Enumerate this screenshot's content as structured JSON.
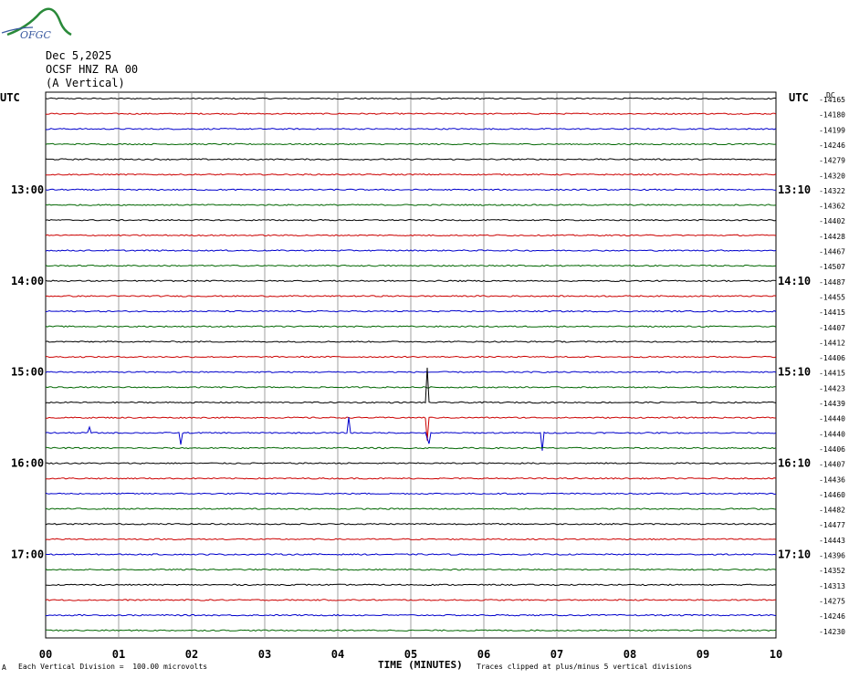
{
  "header": {
    "logo_text": "OFGC",
    "date": "Dec 5,2025",
    "station": "OCSF HNZ RA 00",
    "component": "(A Vertical)"
  },
  "left_axis_label": "UTC",
  "right_axis_label": "UTC",
  "right_top_label": "DC",
  "footer": {
    "left_mark": "A",
    "scale_note": "Each Vertical Division =  100.00 microvolts",
    "xlabel": "TIME (MINUTES)",
    "clip_note": "Traces clipped at plus/minus 5 vertical divisions"
  },
  "chart_data": {
    "type": "line",
    "title": "",
    "xlabel": "TIME (MINUTES)",
    "ylabel": "UTC",
    "xlim": [
      0,
      10
    ],
    "x_ticks": [
      "00",
      "01",
      "02",
      "03",
      "04",
      "05",
      "06",
      "07",
      "08",
      "09",
      "10"
    ],
    "grid": true,
    "trace_colors": [
      "#000000",
      "#cc0000",
      "#0000cc",
      "#006600"
    ],
    "left_time_labels": [
      {
        "row": 6,
        "label": "13:00"
      },
      {
        "row": 12,
        "label": "14:00"
      },
      {
        "row": 18,
        "label": "15:00"
      },
      {
        "row": 24,
        "label": "16:00"
      },
      {
        "row": 30,
        "label": "17:00"
      }
    ],
    "right_time_labels": [
      {
        "row": 6,
        "label": "13:10"
      },
      {
        "row": 12,
        "label": "14:10"
      },
      {
        "row": 18,
        "label": "15:10"
      },
      {
        "row": 24,
        "label": "16:10"
      },
      {
        "row": 30,
        "label": "17:10"
      }
    ],
    "dc_offsets": [
      "-14165",
      "-14180",
      "-14199",
      "-14246",
      "-14279",
      "-14320",
      "-14322",
      "-14362",
      "-14402",
      "-14428",
      "-14467",
      "-14507",
      "-14487",
      "-14455",
      "-14415",
      "-14407",
      "-14412",
      "-14406",
      "-14415",
      "-14423",
      "-14439",
      "-14440",
      "-14440",
      "-14406",
      "-14407",
      "-14436",
      "-14460",
      "-14482",
      "-14477",
      "-14443",
      "-14396",
      "-14352",
      "-14313",
      "-14275",
      "-14246",
      "-14230"
    ],
    "events": [
      {
        "row": 20,
        "minute": 5.22,
        "amplitude": 3.0
      },
      {
        "row": 21,
        "minute": 5.22,
        "amplitude": -2.0
      },
      {
        "row": 22,
        "minute": 5.24,
        "amplitude": -1.5
      },
      {
        "row": 22,
        "minute": 4.15,
        "amplitude": 1.0
      },
      {
        "row": 22,
        "minute": 6.8,
        "amplitude": -1.2
      },
      {
        "row": 22,
        "minute": 1.85,
        "amplitude": -0.8
      },
      {
        "row": 22,
        "minute": 0.6,
        "amplitude": 0.4
      }
    ]
  }
}
